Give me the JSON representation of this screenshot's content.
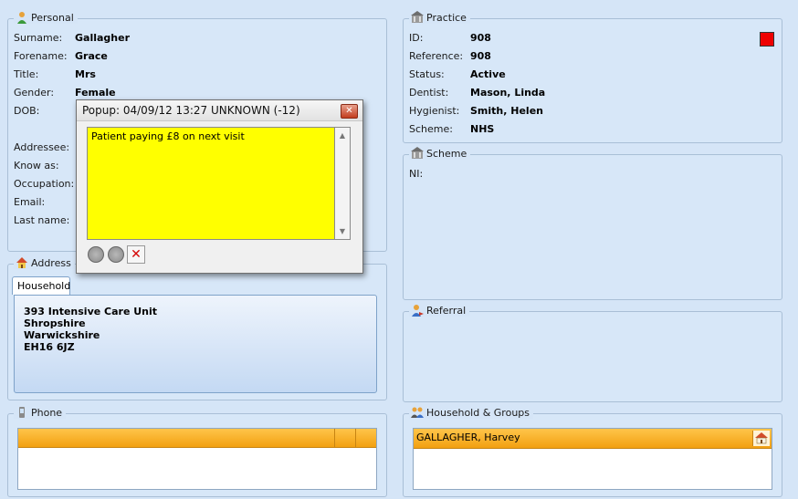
{
  "personal": {
    "legend": "Personal",
    "fields": [
      {
        "label": "Surname:",
        "value": "Gallagher"
      },
      {
        "label": "Forename:",
        "value": "Grace"
      },
      {
        "label": "Title:",
        "value": "Mrs"
      },
      {
        "label": "Gender:",
        "value": "Female"
      },
      {
        "label": "DOB:",
        "value": ""
      },
      {
        "label": "Addressee:",
        "value": ""
      },
      {
        "label": "Know as:",
        "value": ""
      },
      {
        "label": "Occupation:",
        "value": ""
      },
      {
        "label": "Email:",
        "value": ""
      },
      {
        "label": "Last name:",
        "value": ""
      }
    ]
  },
  "practice": {
    "legend": "Practice",
    "status_color": "#ee0000",
    "fields": [
      {
        "label": "ID:",
        "value": "908"
      },
      {
        "label": "Reference:",
        "value": "908"
      },
      {
        "label": "Status:",
        "value": "Active"
      },
      {
        "label": "Dentist:",
        "value": "Mason, Linda"
      },
      {
        "label": "Hygienist:",
        "value": "Smith, Helen"
      },
      {
        "label": "Scheme:",
        "value": "NHS"
      }
    ]
  },
  "scheme": {
    "legend": "Scheme",
    "fields": [
      {
        "label": "NI:",
        "value": ""
      }
    ]
  },
  "address": {
    "legend": "Address",
    "tab": "Household",
    "lines": [
      "393 Intensive Care Unit",
      "Shropshire",
      "Warwickshire",
      "EH16 6JZ"
    ]
  },
  "referral": {
    "legend": "Referral"
  },
  "phone": {
    "legend": "Phone"
  },
  "household": {
    "legend": "Household & Groups",
    "members": [
      "GALLAGHER, Harvey"
    ]
  },
  "popup": {
    "title": "Popup: 04/09/12 13:27 UNKNOWN (-12)",
    "note": "Patient paying £8 on next visit",
    "close_glyph": "✕",
    "delete_glyph": "✕"
  }
}
